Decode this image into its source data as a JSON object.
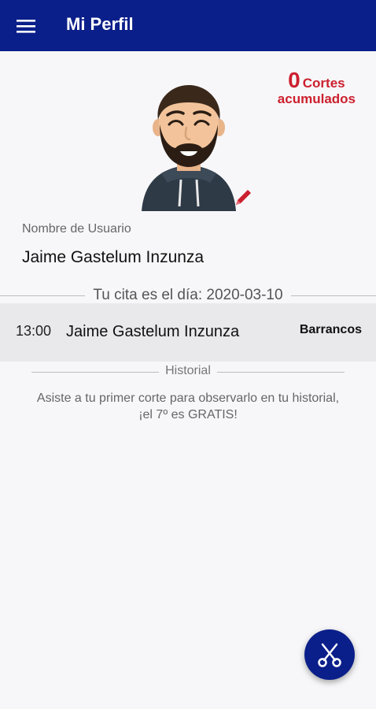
{
  "appbar": {
    "title": "Mi Perfil",
    "menu_icon": "hamburger-menu-icon"
  },
  "counter": {
    "count": "0",
    "label": "Cortes",
    "sublabel": "acumulados",
    "color": "#cc1f2e"
  },
  "profile": {
    "avatar_icon": "bearded-man-avatar",
    "edit_icon": "pencil-icon",
    "username_label": "Nombre de Usuario",
    "username_value": "Jaime Gastelum Inzunza"
  },
  "appointment": {
    "title": "Tu cita es el día: 2020-03-10",
    "time": "13:00",
    "client": "Jaime Gastelum Inzunza",
    "location": "Barrancos"
  },
  "history": {
    "title": "Historial",
    "message": "Asiste a tu primer corte para observarlo en tu historial, ¡el 7º es GRATIS!"
  },
  "fab": {
    "icon": "scissors-icon"
  },
  "colors": {
    "primary": "#0b1f8a",
    "accent": "#cc1f2e",
    "background": "#f7f7f9"
  }
}
